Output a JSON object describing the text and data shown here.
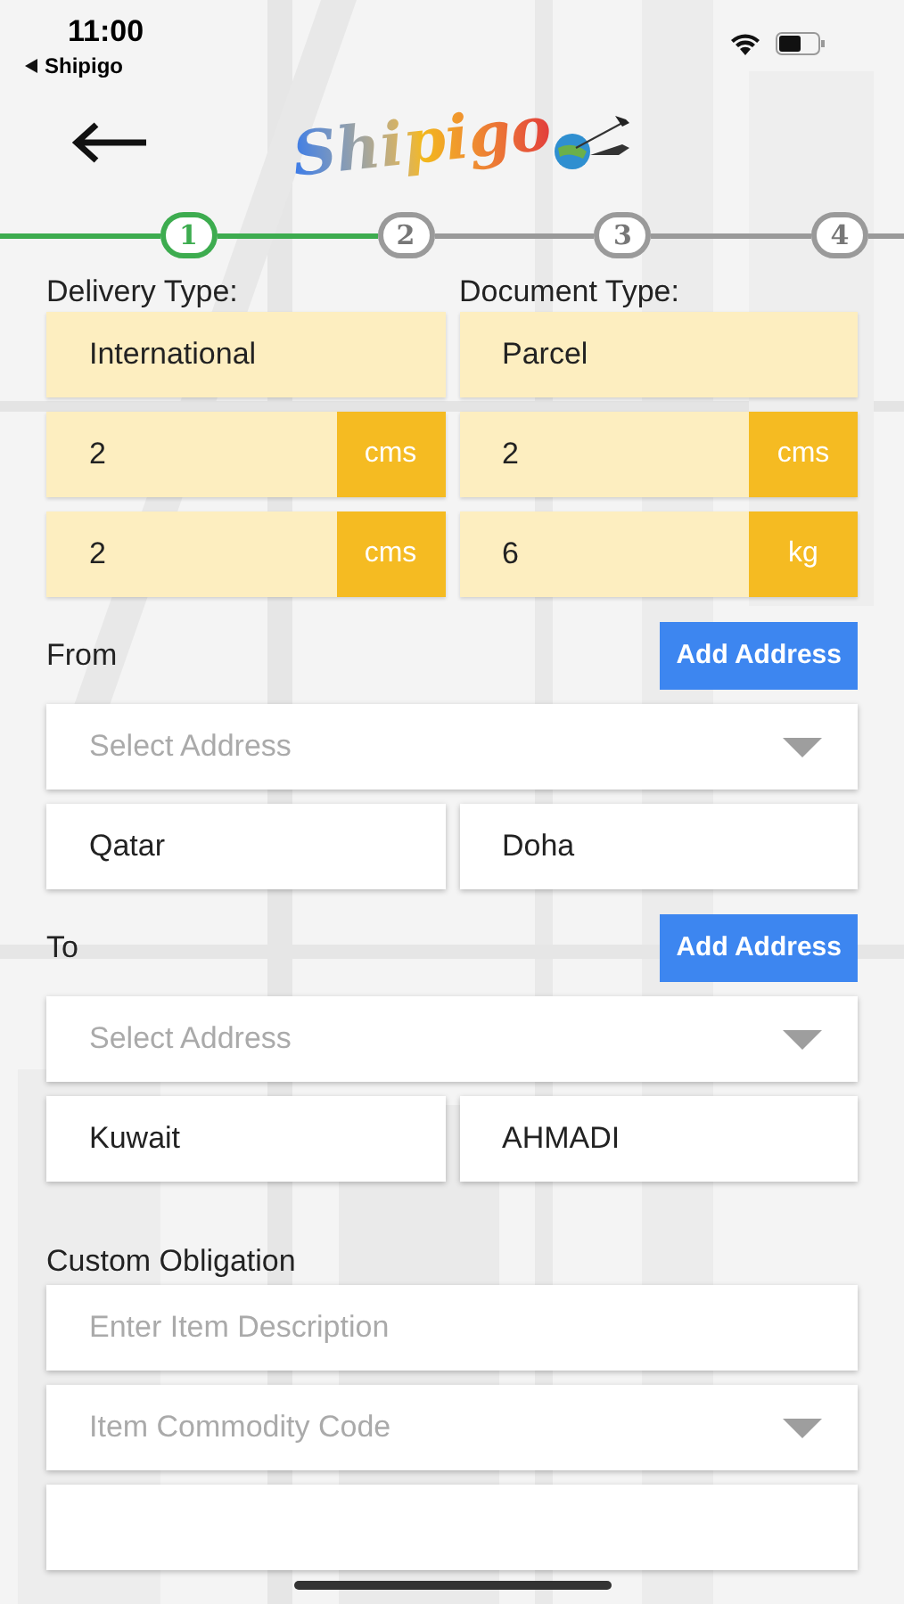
{
  "status_bar": {
    "time": "11:00",
    "back_app": "Shipigo"
  },
  "header": {
    "logo": "Shipigo"
  },
  "stepper": [
    {
      "label": "1",
      "selected": true
    },
    {
      "label": "2",
      "selected": false
    },
    {
      "label": "3",
      "selected": false
    },
    {
      "label": "4",
      "selected": false
    }
  ],
  "shipment": {
    "labels": [
      "Delivery Type:",
      "Document Type:"
    ],
    "fields": [
      {
        "value": "International"
      },
      {
        "value": "Parcel"
      },
      {
        "value": "2",
        "unit": "cms"
      },
      {
        "value": "2",
        "unit": "cms"
      },
      {
        "value": "2",
        "unit": "cms"
      },
      {
        "value": "6",
        "unit": "kg"
      }
    ]
  },
  "addresses": [
    {
      "label": "From",
      "button": "Add Address",
      "select_placeholder": "Select Address",
      "country": "Qatar",
      "city": "Doha"
    },
    {
      "label": "To",
      "button": "Add Address",
      "select_placeholder": "Select Address",
      "country": "Kuwait",
      "city": "AHMADI"
    }
  ],
  "custom": {
    "label": "Custom Obligation",
    "fields": [
      {
        "kind": "text",
        "placeholder": "Enter Item Description"
      },
      {
        "kind": "select",
        "placeholder": "Item Commodity Code"
      },
      {
        "kind": "text"
      }
    ]
  }
}
